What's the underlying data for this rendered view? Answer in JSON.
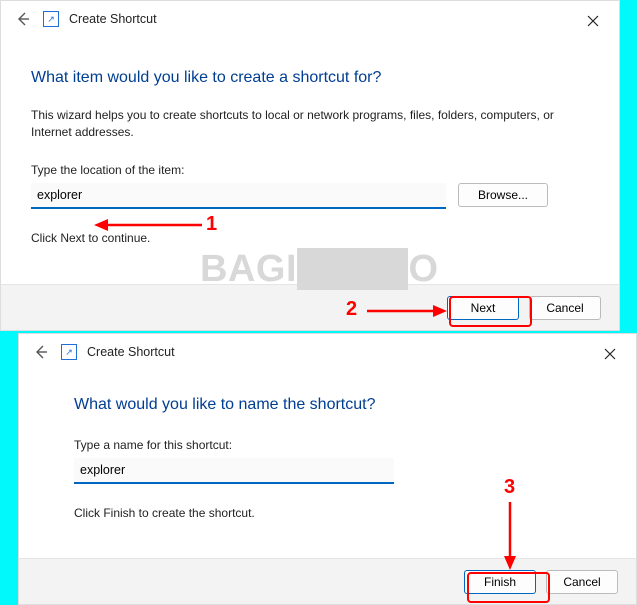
{
  "watermark": "BAGITEKNO",
  "dialog1": {
    "title": "Create Shortcut",
    "heading": "What item would you like to create a shortcut for?",
    "description": "This wizard helps you to create shortcuts to local or network programs, files, folders, computers, or Internet addresses.",
    "location_label": "Type the location of the item:",
    "location_value": "explorer",
    "browse_label": "Browse...",
    "hint": "Click Next to continue.",
    "next_label": "Next",
    "cancel_label": "Cancel"
  },
  "dialog2": {
    "title": "Create Shortcut",
    "heading": "What would you like to name the shortcut?",
    "name_label": "Type a name for this shortcut:",
    "name_value": "explorer",
    "hint": "Click Finish to create the shortcut.",
    "finish_label": "Finish",
    "cancel_label": "Cancel"
  },
  "annotations": {
    "step1": "1",
    "step2": "2",
    "step3": "3"
  }
}
